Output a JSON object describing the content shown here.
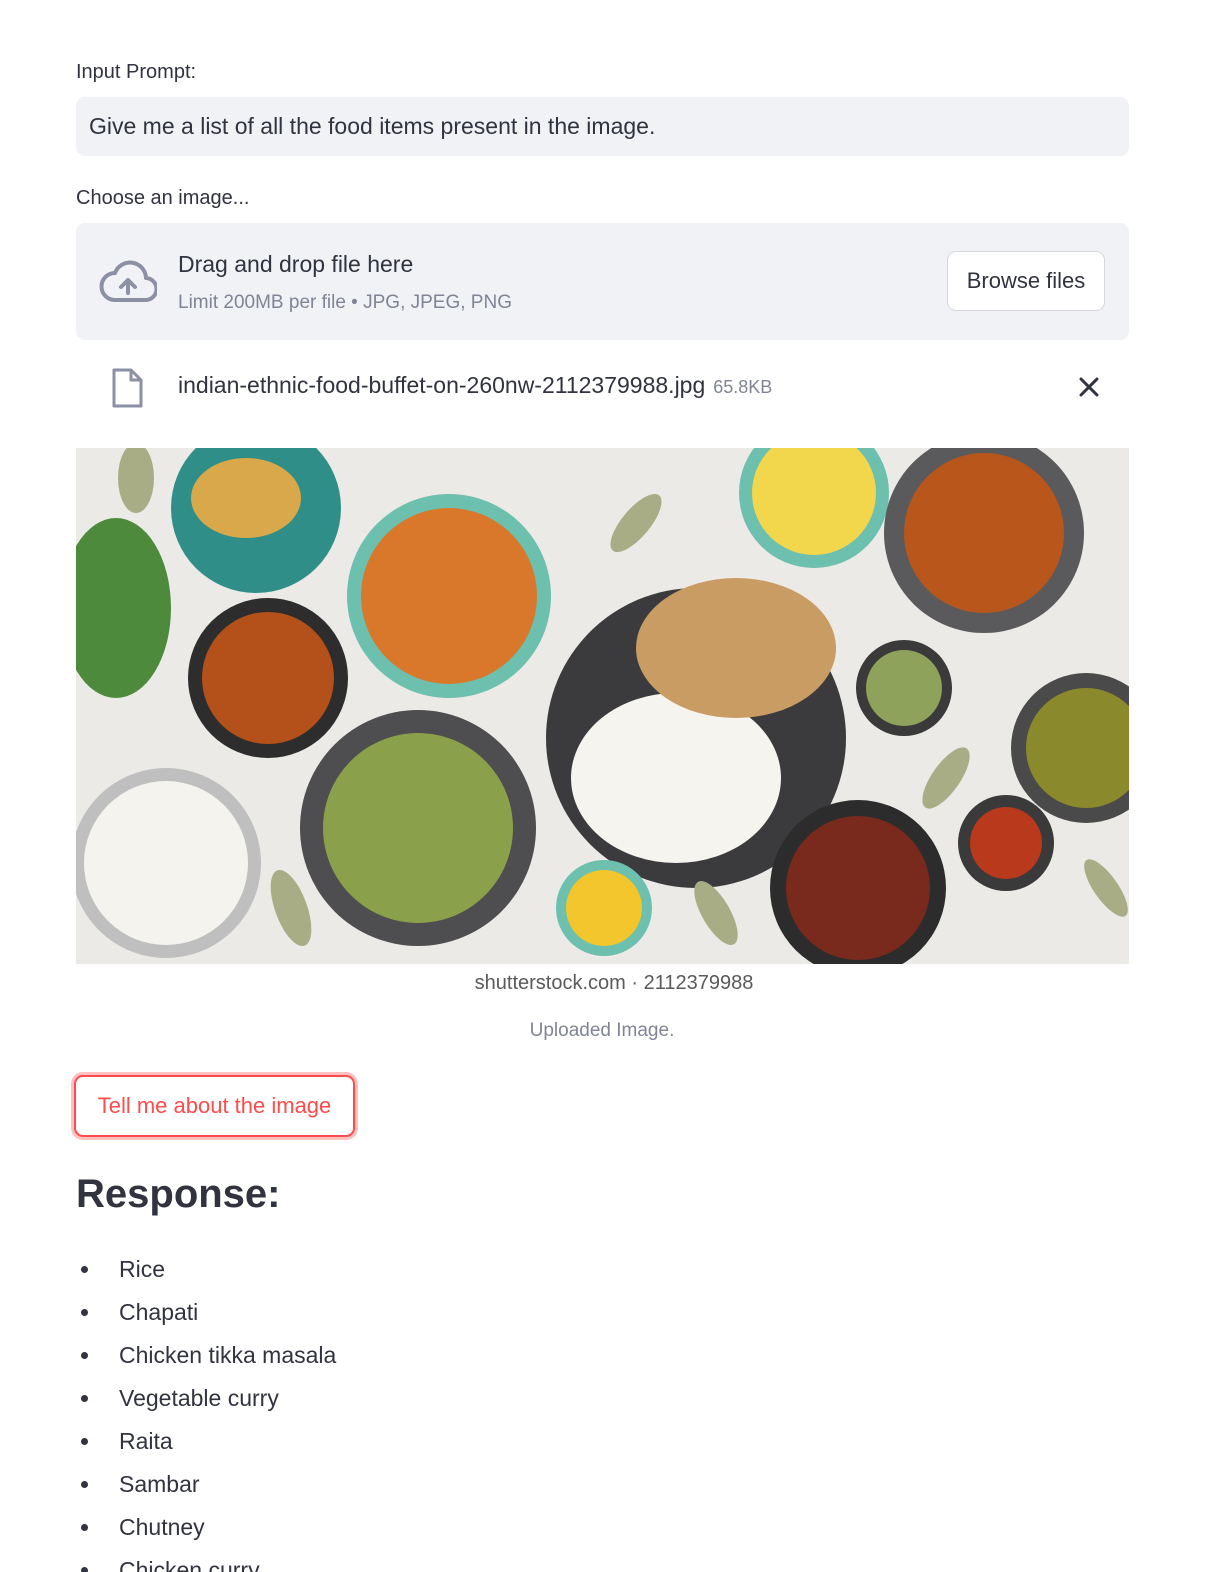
{
  "prompt": {
    "label": "Input Prompt:",
    "value": "Give me a list of all the food items present in the image."
  },
  "uploader": {
    "label": "Choose an image...",
    "drop_title": "Drag and drop file here",
    "drop_subtitle": "Limit 200MB per file • JPG, JPEG, PNG",
    "browse_label": "Browse files",
    "icon": "cloud-upload-icon"
  },
  "file": {
    "name": "indian-ethnic-food-buffet-on-260nw-2112379988.jpg",
    "size": "65.8KB",
    "icon": "file-icon",
    "remove_icon": "close-icon"
  },
  "image": {
    "watermark": "shutterstock.com · 2112379988",
    "caption": "Uploaded Image."
  },
  "action": {
    "button_label": "Tell me about the image"
  },
  "response": {
    "heading": "Response:",
    "items": [
      "Rice",
      "Chapati",
      "Chicken tikka masala",
      "Vegetable curry",
      "Raita",
      "Sambar",
      "Chutney",
      "Chicken curry"
    ]
  },
  "colors": {
    "accent": "#ff4b4b",
    "text": "#31333f",
    "muted": "#808495",
    "input_bg": "#f0f2f6"
  }
}
